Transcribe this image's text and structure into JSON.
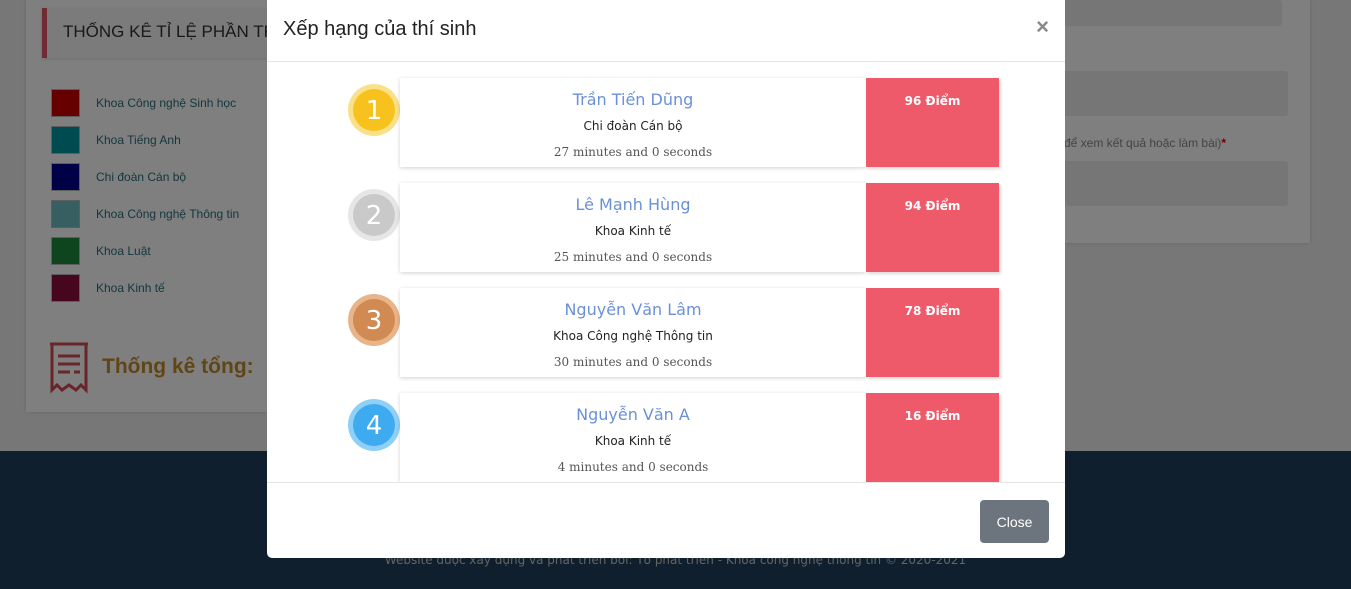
{
  "background": {
    "stats_title": "THỐNG KÊ TỈ LỆ PHẦN TRĂ",
    "legend": [
      {
        "label": "Khoa Công nghệ Sinh học",
        "color": "#cc0000"
      },
      {
        "label": "Khoa Tiếng Anh",
        "color": "#0096a0"
      },
      {
        "label": "Chi đoàn Cán bộ",
        "color": "#00008c"
      },
      {
        "label": "Khoa Công nghệ Thông tin",
        "color": "#6fbcc2"
      },
      {
        "label": "Khoa Luật",
        "color": "#1f8a3c"
      },
      {
        "label": "Khoa Kinh tế",
        "color": "#8c0f3c"
      }
    ],
    "total_label": "Thống kê tổng:",
    "hint_text": "để xem kết quả hoặc làm bài)",
    "hint_required": "*",
    "footer_text": "Website được xây dựng và phát triển bởi: Tổ phát triển - Khoa công nghệ thông tin © 2020-2021"
  },
  "modal": {
    "title": "Xếp hạng của thí sinh",
    "close_symbol": "×",
    "close_button": "Close",
    "rankings": [
      {
        "rank": "1",
        "name": "Trần Tiến Dũng",
        "dept": "Chi đoàn Cán bộ",
        "time": "27 minutes and 0 seconds",
        "score": "96 Điểm",
        "medal_color": "#f7c21e",
        "medal_ring": "#fbe08a"
      },
      {
        "rank": "2",
        "name": "Lê Mạnh Hùng",
        "dept": "Khoa Kinh tế",
        "time": "25 minutes and 0 seconds",
        "score": "94 Điểm",
        "medal_color": "#c9c9c9",
        "medal_ring": "#e6e6e6"
      },
      {
        "rank": "3",
        "name": "Nguyễn Văn Lâm",
        "dept": "Khoa Công nghệ Thông tin",
        "time": "30 minutes and 0 seconds",
        "score": "78 Điểm",
        "medal_color": "#d18a52",
        "medal_ring": "#e8b48a"
      },
      {
        "rank": "4",
        "name": "Nguyễn Văn A",
        "dept": "Khoa Kinh tế",
        "time": "4 minutes and 0 seconds",
        "score": "16 Điểm",
        "medal_color": "#3eaaf0",
        "medal_ring": "#8fd0f8"
      }
    ]
  }
}
